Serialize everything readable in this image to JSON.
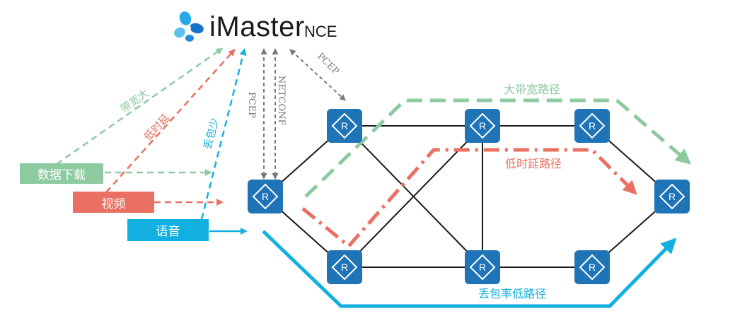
{
  "brand": {
    "name": "iMaster",
    "suffix": "NCE"
  },
  "services": [
    {
      "label": "数据下载",
      "color": "#8dcaa0"
    },
    {
      "label": "视频",
      "color": "#ea7062"
    },
    {
      "label": "语音",
      "color": "#12b0e0"
    }
  ],
  "requirement_labels": {
    "bandwidth": "带宽大",
    "latency": "低时延",
    "loss": "丢包少"
  },
  "protocols": {
    "pcep_left": "PCEP",
    "netconf": "NETCONF",
    "pcep_right": "PCEP"
  },
  "paths": {
    "high_bandwidth": {
      "label": "大带宽路径",
      "color": "#8dcaa0"
    },
    "low_latency": {
      "label": "低时延路径",
      "color": "#ea7062"
    },
    "low_loss": {
      "label": "丢包率低路径",
      "color": "#12b0e0"
    }
  },
  "router_glyph": "R",
  "colors": {
    "router_fill": "#1f73b7",
    "link": "#1a1a1a",
    "protocol": "#7a7a7a"
  }
}
